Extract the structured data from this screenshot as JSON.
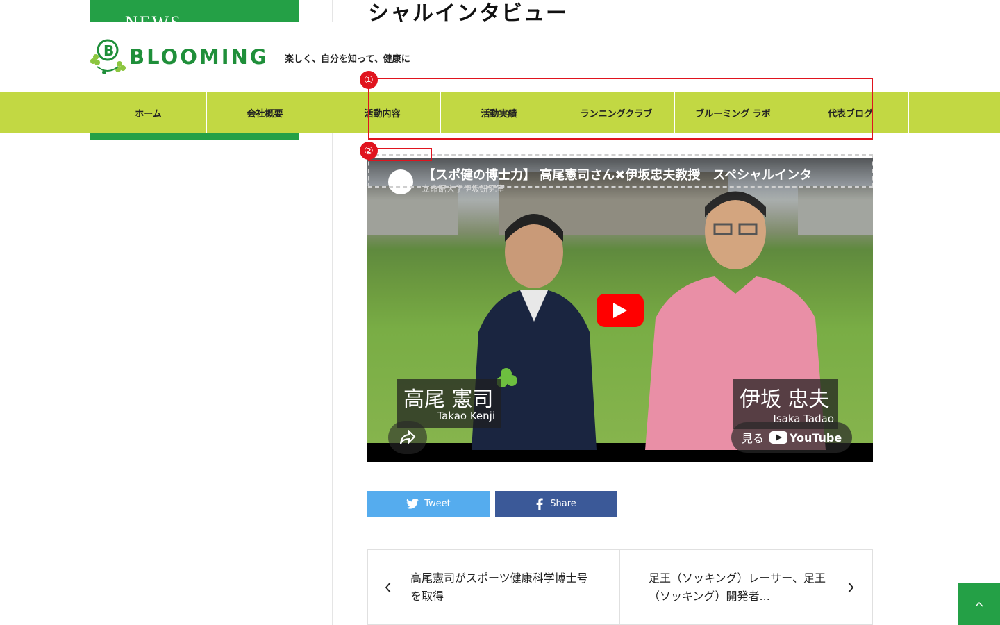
{
  "sidebar": {
    "box_label": "NEWS"
  },
  "article": {
    "title_partial": "シャルインタビュー"
  },
  "header": {
    "logo_text": "BLOOMING",
    "tagline": "楽しく、自分を知って、健康に"
  },
  "nav": {
    "items": [
      "ホーム",
      "会社概要",
      "活動内容",
      "活動実績",
      "ランニングクラブ",
      "ブルーミング ラボ",
      "代表ブログ"
    ]
  },
  "annotations": {
    "first": "①",
    "second": "②"
  },
  "video": {
    "title": "【スポ健の博士力】 高尾憲司さん✖伊坂忠夫教授　スペシャルインタ",
    "channel": "立命館大学伊坂研究室",
    "name_left_jp": "高尾 憲司",
    "name_left_en": "Takao Kenji",
    "name_right_jp": "伊坂 忠夫",
    "name_right_en": "Isaka Tadao",
    "watch_label": "見る",
    "youtube_label": "YouTube"
  },
  "social": {
    "tweet": "Tweet",
    "share": "Share"
  },
  "post_nav": {
    "prev_line1": "高尾憲司がスポーツ健康科学博士号",
    "prev_line2": "を取得",
    "next_line1": "足王（ソッキング）レーサー、足王",
    "next_line2": "（ソッキング）開発者..."
  },
  "colors": {
    "brand_green": "#24a046",
    "nav_bg": "#c2d843",
    "twitter": "#55acee",
    "facebook": "#3b5998",
    "annotation_red": "#e0141e"
  }
}
